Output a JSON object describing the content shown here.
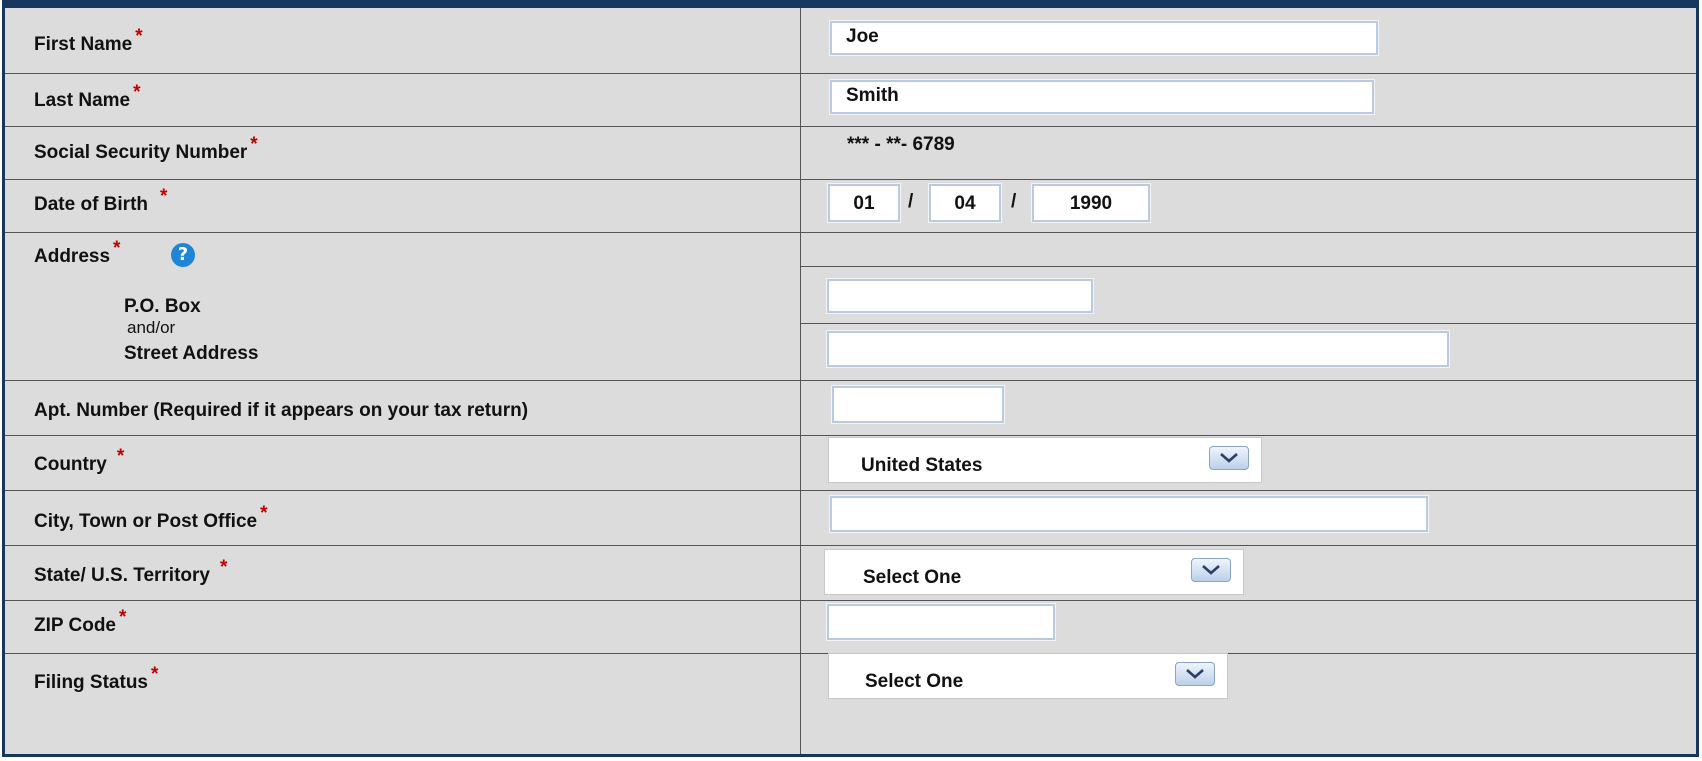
{
  "fields": {
    "first_name": {
      "label": "First Name",
      "value": "Joe"
    },
    "last_name": {
      "label": "Last Name",
      "value": "Smith"
    },
    "ssn": {
      "label": "Social Security Number",
      "value": "*** - **-  6789"
    },
    "dob": {
      "label": "Date of Birth",
      "month": "01",
      "day": "04",
      "year": "1990",
      "separator": "/"
    },
    "address": {
      "label": "Address",
      "po_box_label": "P.O. Box",
      "andor": "and/or",
      "street_label": "Street Address",
      "po_box_value": "",
      "street_value": ""
    },
    "apt": {
      "label": "Apt. Number (Required if it appears on your tax return)",
      "value": ""
    },
    "country": {
      "label": "Country",
      "value": "United States"
    },
    "city": {
      "label": "City, Town or Post Office",
      "value": ""
    },
    "state": {
      "label": "State/ U.S. Territory",
      "value": "Select One"
    },
    "zip": {
      "label": "ZIP Code",
      "value": ""
    },
    "filing_status": {
      "label": "Filing Status",
      "value": "Select One"
    }
  },
  "required_marker": "*",
  "help_symbol": "?",
  "icons": {
    "help": "help-icon",
    "dropdown": "chevron-down-icon"
  },
  "colors": {
    "border": "#17375e",
    "required": "#c00000",
    "help": "#1e86d8",
    "row_bg": "#dcdcdc"
  }
}
